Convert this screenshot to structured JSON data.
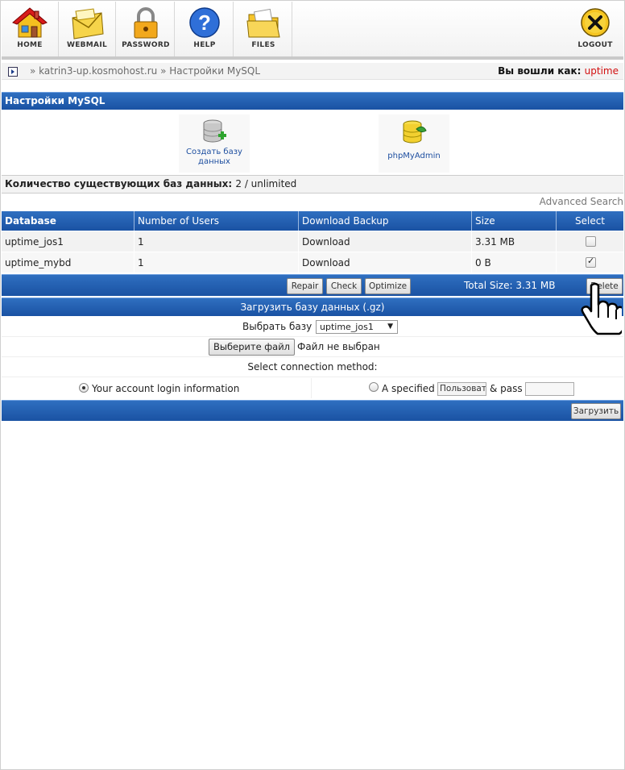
{
  "toolbar": {
    "items": [
      {
        "label": "HOME",
        "icon": "home-icon"
      },
      {
        "label": "WEBMAIL",
        "icon": "mail-icon"
      },
      {
        "label": "PASSWORD",
        "icon": "lock-icon"
      },
      {
        "label": "HELP",
        "icon": "help-icon"
      },
      {
        "label": "FILES",
        "icon": "folder-icon"
      }
    ],
    "logout": "LOGOUT"
  },
  "breadcrumb": {
    "domain": "katrin3-up.kosmohost.ru",
    "page": "Настройки MySQL",
    "separator": "»"
  },
  "login": {
    "label": "Вы вошли как:",
    "user": "uptime"
  },
  "section": {
    "title": "Настройки MySQL"
  },
  "actions": {
    "create_db": "Создать базу данных",
    "phpmyadmin": "phpMyAdmin"
  },
  "count": {
    "label": "Количество существующих баз данных:",
    "value": "2 / unlimited"
  },
  "advanced_search": "Advanced Search",
  "table": {
    "headers": [
      "Database",
      "Number of Users",
      "Download Backup",
      "Size",
      "Select"
    ],
    "rows": [
      {
        "database": "uptime_jos1",
        "users": "1",
        "backup": "Download",
        "size": "3.31 MB",
        "selected": false
      },
      {
        "database": "uptime_mybd",
        "users": "1",
        "backup": "Download",
        "size": "0 B",
        "selected": true
      }
    ]
  },
  "table_actions": {
    "repair": "Repair",
    "check": "Check",
    "optimize": "Optimize",
    "total_size": "Total Size: 3.31 MB",
    "delete": "Delete"
  },
  "upload": {
    "title": "Загрузить базу данных (.gz)",
    "select_label": "Выбрать базу",
    "select_value": "uptime_jos1",
    "file_button": "Выберите файл",
    "file_status": "Файл не выбран",
    "method_label": "Select connection method:",
    "option_account": "Your account login information",
    "option_specified": "A specified",
    "user_placeholder": "Пользоват",
    "pass_label": "& pass",
    "submit": "Загрузить"
  },
  "colors": {
    "header_blue": "#1a52a3",
    "login_user": "#d21010",
    "link_blue": "#1e4fa0"
  }
}
